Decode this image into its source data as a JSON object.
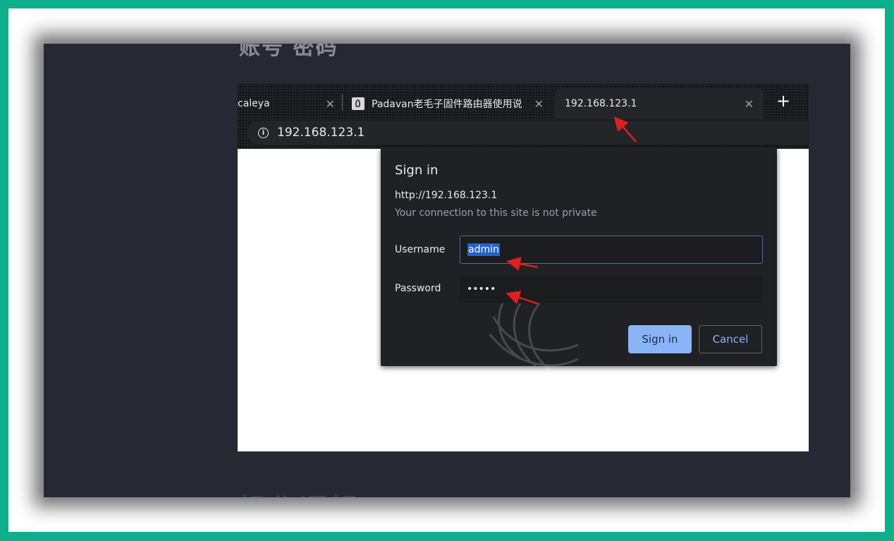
{
  "article": {
    "top_partial_text": "账号 密码",
    "bottom_heading": "操作逻辑"
  },
  "browser": {
    "tabs": [
      {
        "label": "caleya",
        "active": false,
        "close_glyph": "✕"
      },
      {
        "label": "Padavan老毛子固件路由器使用说",
        "favicon": "padavan-logo-icon",
        "active": false,
        "close_glyph": "✕"
      },
      {
        "label": "192.168.123.1",
        "active": true,
        "close_glyph": "✕"
      }
    ],
    "new_tab_glyph": "+",
    "address": "192.168.123.1",
    "info_glyph": "i"
  },
  "dialog": {
    "title": "Sign in",
    "origin": "http://192.168.123.1",
    "warning": "Your connection to this site is not private",
    "username_label": "Username",
    "username_value": "admin",
    "password_label": "Password",
    "password_value": "•••••",
    "sign_in_label": "Sign in",
    "cancel_label": "Cancel"
  },
  "colors": {
    "outer_border": "#0eaf8c",
    "annotation_arrow": "#e01e1e",
    "primary_button": "#8ab4f8"
  }
}
